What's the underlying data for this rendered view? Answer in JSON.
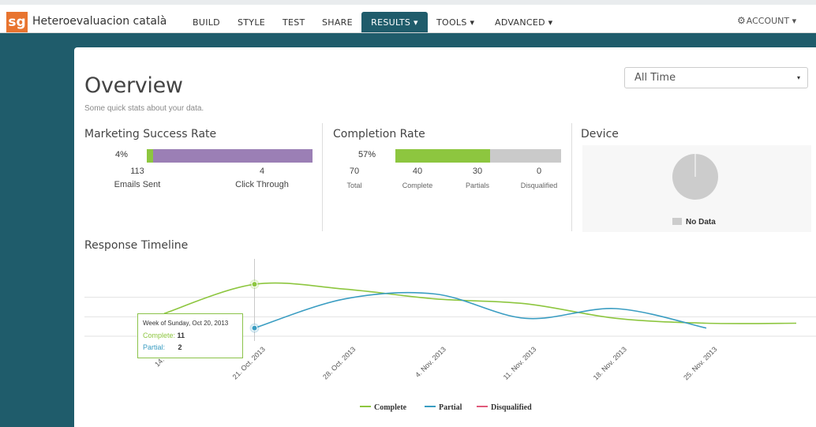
{
  "app": {
    "logo": "sg",
    "survey_title": "Heteroevaluacion català"
  },
  "nav": {
    "build": "BUILD",
    "style": "STYLE",
    "test": "TEST",
    "share": "SHARE",
    "results": "RESULTS ▾",
    "tools": "TOOLS ▾",
    "advanced": "ADVANCED ▾",
    "account": "ACCOUNT ▾"
  },
  "icons": {
    "account": "gear-icon",
    "dropdown": "caret-down-icon"
  },
  "overview": {
    "title": "Overview",
    "subtitle": "Some quick stats about your data.",
    "range_select": {
      "value": "All Time",
      "arrow": "▾"
    }
  },
  "marketing": {
    "title": "Marketing Success Rate",
    "percent_label": "4%",
    "percent": 0.04,
    "emails_sent": "113",
    "emails_sent_label": "Emails Sent",
    "click_through": "4",
    "click_through_label": "Click Through"
  },
  "completion": {
    "title": "Completion Rate",
    "percent_label": "57%",
    "percent": 0.57,
    "total": "70",
    "total_label": "Total",
    "complete": "40",
    "complete_label": "Complete",
    "partials": "30",
    "partials_label": "Partials",
    "disqualified": "0",
    "disqualified_label": "Disqualified"
  },
  "device": {
    "title": "Device",
    "no_data": "No Data"
  },
  "timeline": {
    "title": "Response Timeline",
    "tooltip": {
      "week": "Week of Sunday, Oct 20, 2013",
      "complete_label": "Complete:",
      "complete_value": "11",
      "partial_label": "Partial:",
      "partial_value": "2"
    },
    "legend": {
      "complete": "Complete",
      "partial": "Partial",
      "disqualified": "Disqualified"
    }
  },
  "colors": {
    "complete": "#8dc63f",
    "partial": "#3a9dc2",
    "disqualified": "#e05a7a",
    "marketing_bar": "#9b7fb5",
    "header": "#1f5c6b",
    "logo": "#e8742f"
  },
  "chart_data": {
    "type": "line",
    "title": "Response Timeline",
    "x": [
      "14. Oct.",
      "21. Oct. 2013",
      "28. Oct. 2013",
      "4. Nov. 2013",
      "11. Nov. 2013",
      "18. Nov. 2013",
      "25. Nov. 2013"
    ],
    "series": [
      {
        "name": "Complete",
        "values": [
          5,
          11,
          10,
          8,
          7,
          4,
          3
        ]
      },
      {
        "name": "Partial",
        "values": [
          null,
          2,
          8,
          9,
          4,
          6,
          2
        ]
      },
      {
        "name": "Disqualified",
        "values": [
          0,
          0,
          0,
          0,
          0,
          0,
          0
        ]
      }
    ],
    "grid": true,
    "legend": "bottom"
  }
}
